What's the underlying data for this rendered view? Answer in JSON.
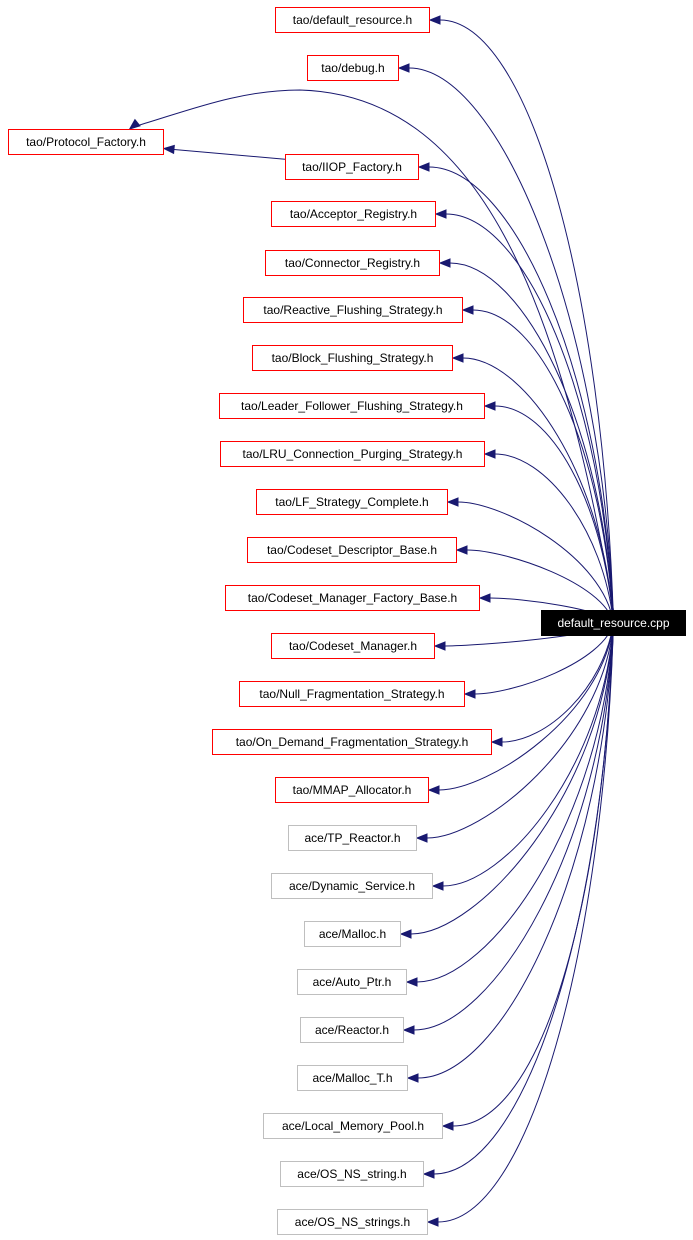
{
  "diagram": {
    "type": "include-dependency-graph",
    "root": {
      "id": "root",
      "label": "default_resource.cpp"
    },
    "colors": {
      "edge": "#191970",
      "documented_border": "#ff0000",
      "undocumented_border": "#bfbfbf",
      "root_fill": "#000000",
      "root_text": "#ffffff"
    },
    "nodes": [
      {
        "id": "n0",
        "label": "tao/default_resource.h",
        "kind": "documented"
      },
      {
        "id": "n1",
        "label": "tao/debug.h",
        "kind": "documented"
      },
      {
        "id": "n2",
        "label": "tao/Protocol_Factory.h",
        "kind": "documented"
      },
      {
        "id": "n3",
        "label": "tao/IIOP_Factory.h",
        "kind": "documented"
      },
      {
        "id": "n4",
        "label": "tao/Acceptor_Registry.h",
        "kind": "documented"
      },
      {
        "id": "n5",
        "label": "tao/Connector_Registry.h",
        "kind": "documented"
      },
      {
        "id": "n6",
        "label": "tao/Reactive_Flushing_Strategy.h",
        "kind": "documented"
      },
      {
        "id": "n7",
        "label": "tao/Block_Flushing_Strategy.h",
        "kind": "documented"
      },
      {
        "id": "n8",
        "label": "tao/Leader_Follower_Flushing_Strategy.h",
        "kind": "documented"
      },
      {
        "id": "n9",
        "label": "tao/LRU_Connection_Purging_Strategy.h",
        "kind": "documented"
      },
      {
        "id": "n10",
        "label": "tao/LF_Strategy_Complete.h",
        "kind": "documented"
      },
      {
        "id": "n11",
        "label": "tao/Codeset_Descriptor_Base.h",
        "kind": "documented"
      },
      {
        "id": "n12",
        "label": "tao/Codeset_Manager_Factory_Base.h",
        "kind": "documented"
      },
      {
        "id": "n13",
        "label": "tao/Codeset_Manager.h",
        "kind": "documented"
      },
      {
        "id": "n14",
        "label": "tao/Null_Fragmentation_Strategy.h",
        "kind": "documented"
      },
      {
        "id": "n15",
        "label": "tao/On_Demand_Fragmentation_Strategy.h",
        "kind": "documented"
      },
      {
        "id": "n16",
        "label": "tao/MMAP_Allocator.h",
        "kind": "documented"
      },
      {
        "id": "n17",
        "label": "ace/TP_Reactor.h",
        "kind": "undocumented"
      },
      {
        "id": "n18",
        "label": "ace/Dynamic_Service.h",
        "kind": "undocumented"
      },
      {
        "id": "n19",
        "label": "ace/Malloc.h",
        "kind": "undocumented"
      },
      {
        "id": "n20",
        "label": "ace/Auto_Ptr.h",
        "kind": "undocumented"
      },
      {
        "id": "n21",
        "label": "ace/Reactor.h",
        "kind": "undocumented"
      },
      {
        "id": "n22",
        "label": "ace/Malloc_T.h",
        "kind": "undocumented"
      },
      {
        "id": "n23",
        "label": "ace/Local_Memory_Pool.h",
        "kind": "undocumented"
      },
      {
        "id": "n24",
        "label": "ace/OS_NS_string.h",
        "kind": "undocumented"
      },
      {
        "id": "n25",
        "label": "ace/OS_NS_strings.h",
        "kind": "undocumented"
      }
    ],
    "edges": [
      {
        "from": "root",
        "to": "n0"
      },
      {
        "from": "root",
        "to": "n1"
      },
      {
        "from": "root",
        "to": "n2"
      },
      {
        "from": "root",
        "to": "n3"
      },
      {
        "from": "n3",
        "to": "n2"
      },
      {
        "from": "root",
        "to": "n4"
      },
      {
        "from": "root",
        "to": "n5"
      },
      {
        "from": "root",
        "to": "n6"
      },
      {
        "from": "root",
        "to": "n7"
      },
      {
        "from": "root",
        "to": "n8"
      },
      {
        "from": "root",
        "to": "n9"
      },
      {
        "from": "root",
        "to": "n10"
      },
      {
        "from": "root",
        "to": "n11"
      },
      {
        "from": "root",
        "to": "n12"
      },
      {
        "from": "root",
        "to": "n13"
      },
      {
        "from": "root",
        "to": "n14"
      },
      {
        "from": "root",
        "to": "n15"
      },
      {
        "from": "root",
        "to": "n16"
      },
      {
        "from": "root",
        "to": "n17"
      },
      {
        "from": "root",
        "to": "n18"
      },
      {
        "from": "root",
        "to": "n19"
      },
      {
        "from": "root",
        "to": "n20"
      },
      {
        "from": "root",
        "to": "n21"
      },
      {
        "from": "root",
        "to": "n22"
      },
      {
        "from": "root",
        "to": "n23"
      },
      {
        "from": "root",
        "to": "n24"
      },
      {
        "from": "root",
        "to": "n25"
      }
    ]
  }
}
